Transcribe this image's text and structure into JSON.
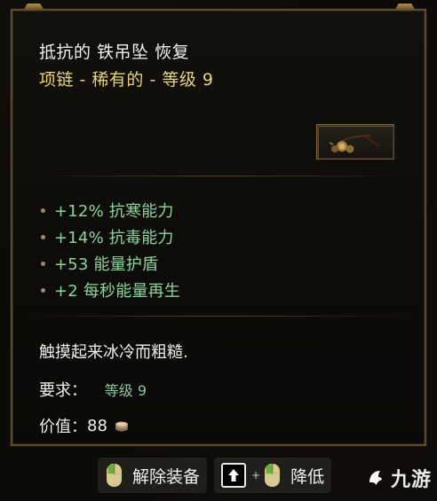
{
  "tooltip": {
    "title": "抵抗的 铁吊坠 恢复",
    "subtitle": "项链 - 稀有的 - 等级 9",
    "stats": [
      "+12% 抗寒能力",
      "+14% 抗毒能力",
      "+53 能量护盾",
      "+2 每秒能量再生"
    ],
    "description": "触摸起来冰冷而粗糙.",
    "requirement_label": "要求：",
    "requirement_value": "等级 9",
    "value_label": "价值：",
    "value_amount": "88"
  },
  "controls": {
    "unequip_label": "解除装备",
    "plus": "+",
    "downgrade_label": "降低"
  },
  "watermark": {
    "text": "九游"
  },
  "colors": {
    "title": "#f1f1ee",
    "rarity": "#e7d37a",
    "stat": "#8fd39b",
    "border": "#5c4a2c"
  },
  "icons": {
    "item": "necklace-icon",
    "coin": "coin-stack-icon",
    "mouse": "mouse-icon",
    "shift": "arrow-up-icon",
    "logo": "logo-icon"
  }
}
